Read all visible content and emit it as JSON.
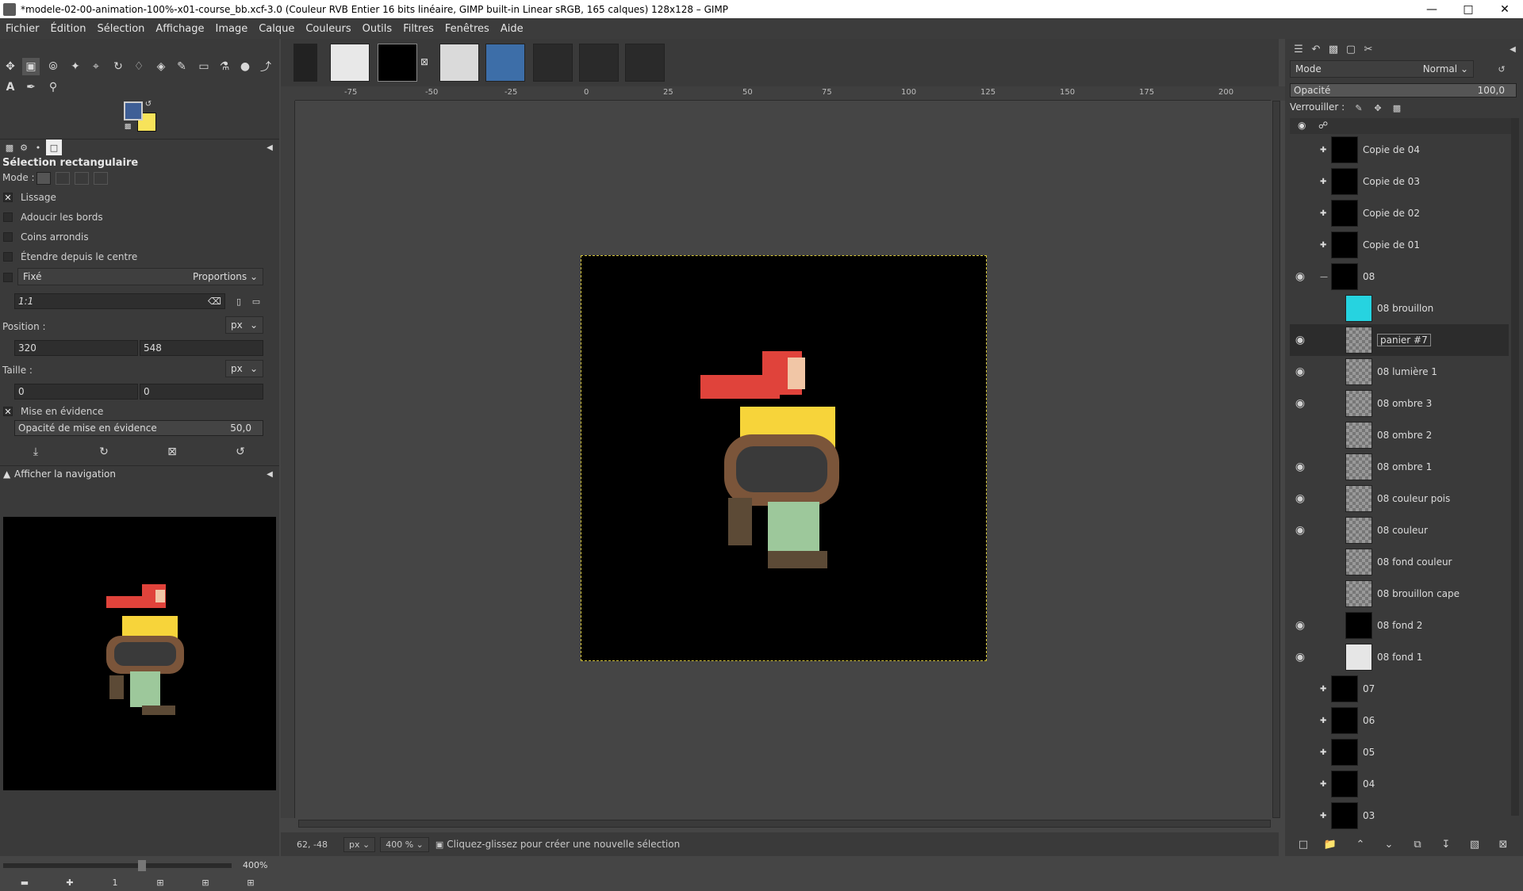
{
  "window": {
    "title": "*modele-02-00-animation-100%-x01-course_bb.xcf-3.0 (Couleur RVB Entier 16 bits linéaire, GIMP built-in Linear sRGB, 165 calques) 128x128 – GIMP"
  },
  "menu": [
    "Fichier",
    "Édition",
    "Sélection",
    "Affichage",
    "Image",
    "Calque",
    "Couleurs",
    "Outils",
    "Filtres",
    "Fenêtres",
    "Aide"
  ],
  "colors": {
    "foreground": "#3f5f96",
    "background": "#f7e35a",
    "canvas_bg": "#454545",
    "selection_dash": "#d6c53b"
  },
  "tool_options": {
    "title": "Sélection rectangulaire",
    "mode_label": "Mode :",
    "antialias": "Lissage",
    "feather": "Adoucir les bords",
    "rounded": "Coins arrondis",
    "expand_center": "Étendre depuis le centre",
    "fixed_label": "Fixé",
    "fixed_mode": "Proportions",
    "ratio": "1:1",
    "position_label": "Position :",
    "position_unit": "px",
    "pos_x": "320",
    "pos_y": "548",
    "size_label": "Taille :",
    "size_unit": "px",
    "size_w": "0",
    "size_h": "0",
    "highlight": "Mise en évidence",
    "highlight_opacity_label": "Opacité de mise en évidence",
    "highlight_opacity": "50,0"
  },
  "navigation": {
    "title": "Afficher la navigation",
    "zoom": "400%"
  },
  "rulers": {
    "h": [
      "-75",
      "-50",
      "-25",
      "0",
      "25",
      "50",
      "75",
      "100",
      "125",
      "150",
      "175",
      "200"
    ]
  },
  "status": {
    "coords": "62, -48",
    "unit": "px",
    "zoom": "400 %",
    "message": "Cliquez-glissez pour créer une nouvelle sélection"
  },
  "layers_panel": {
    "mode_label": "Mode",
    "mode_value": "Normal",
    "opacity_label": "Opacité",
    "opacity_value": "100,0",
    "lock_label": "Verrouiller :",
    "layers": [
      {
        "name": "Copie de 04",
        "visible": false,
        "group": true
      },
      {
        "name": "Copie de 03",
        "visible": false,
        "group": true
      },
      {
        "name": "Copie de 02",
        "visible": false,
        "group": true
      },
      {
        "name": "Copie de 01",
        "visible": false,
        "group": true
      },
      {
        "name": "08",
        "visible": true,
        "group": true
      },
      {
        "name": "08 brouillon",
        "visible": false,
        "group": false
      },
      {
        "name": "panier #7",
        "visible": true,
        "group": false
      },
      {
        "name": "08 lumière 1",
        "visible": true,
        "group": false
      },
      {
        "name": "08 ombre 3",
        "visible": true,
        "group": false
      },
      {
        "name": "08 ombre 2",
        "visible": false,
        "group": false
      },
      {
        "name": "08 ombre 1",
        "visible": true,
        "group": false
      },
      {
        "name": "08 couleur pois",
        "visible": true,
        "group": false
      },
      {
        "name": "08 couleur",
        "visible": true,
        "group": false
      },
      {
        "name": "08 fond couleur",
        "visible": false,
        "group": false
      },
      {
        "name": "08 brouillon cape",
        "visible": false,
        "group": false
      },
      {
        "name": "08 fond 2",
        "visible": true,
        "group": false
      },
      {
        "name": "08 fond 1",
        "visible": true,
        "group": false
      },
      {
        "name": "07",
        "visible": false,
        "group": true
      },
      {
        "name": "06",
        "visible": false,
        "group": true
      },
      {
        "name": "05",
        "visible": false,
        "group": true
      },
      {
        "name": "04",
        "visible": false,
        "group": true
      },
      {
        "name": "03",
        "visible": false,
        "group": true
      }
    ]
  }
}
